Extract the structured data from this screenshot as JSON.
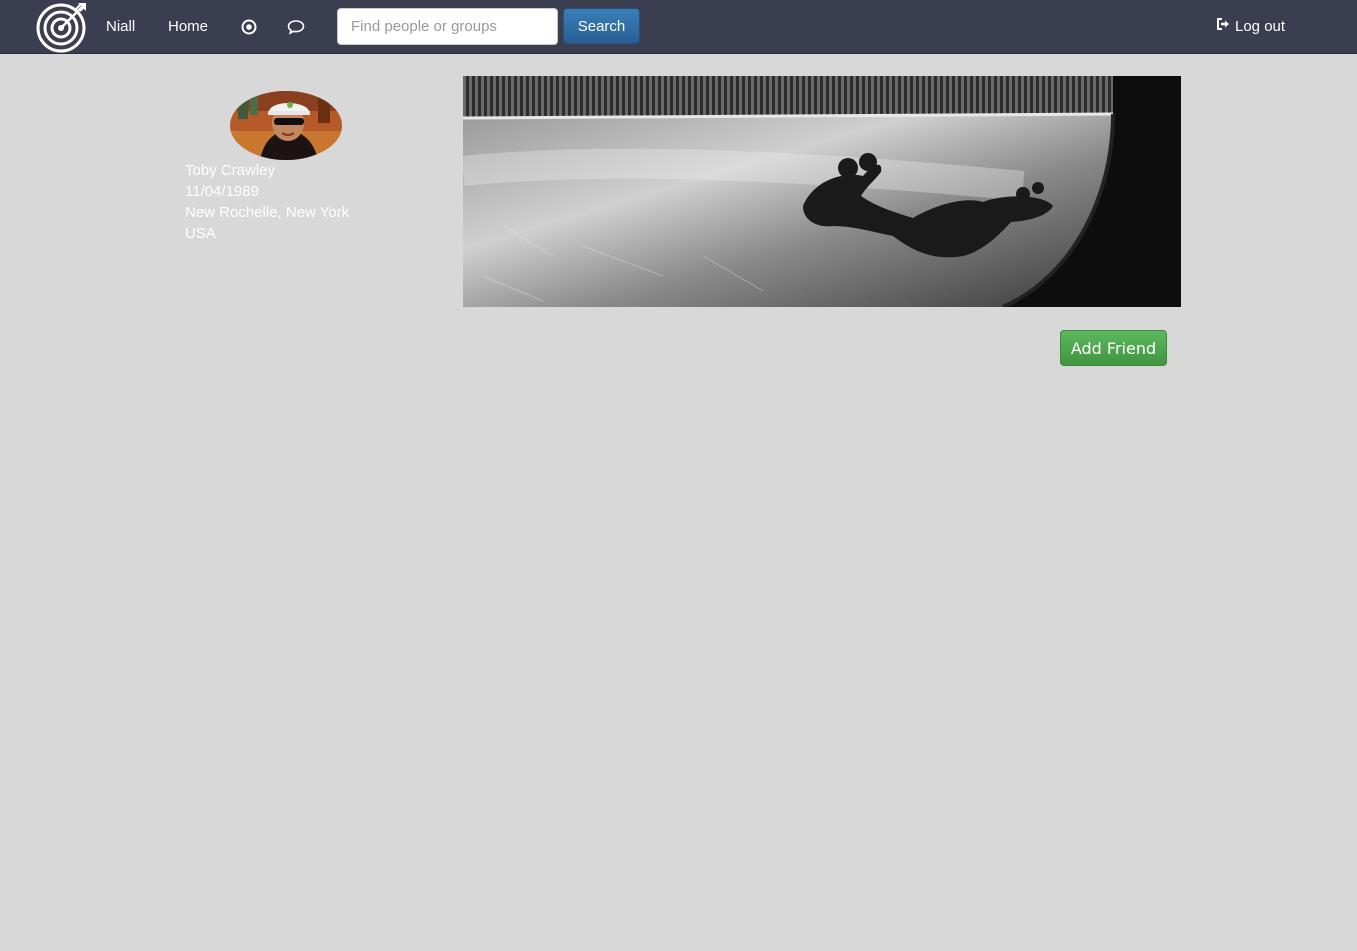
{
  "navbar": {
    "logo_icon": "target-logo-icon",
    "user_name": "Niall",
    "home_label": "Home",
    "target_icon": "target-icon",
    "chat_icon": "chat-bubble-icon",
    "search": {
      "placeholder": "Find people or groups",
      "value": "",
      "button_label": "Search"
    },
    "logout_icon": "logout-icon",
    "logout_label": "Log out"
  },
  "profile": {
    "avatar_icon": "profile-avatar-photo",
    "name": "Toby Crawley",
    "birth_date": "11/04/1989",
    "city": "New Rochelle, New York",
    "country": "USA"
  },
  "cover_photo": "skater-shadow-halfpipe-photo",
  "actions": {
    "add_friend_label": "Add Friend"
  },
  "colors": {
    "navbar_bg": "#3b3d50",
    "page_bg": "#d8d8d8",
    "search_button": "#2f6ea5",
    "add_friend_button": "#4cae4c"
  }
}
